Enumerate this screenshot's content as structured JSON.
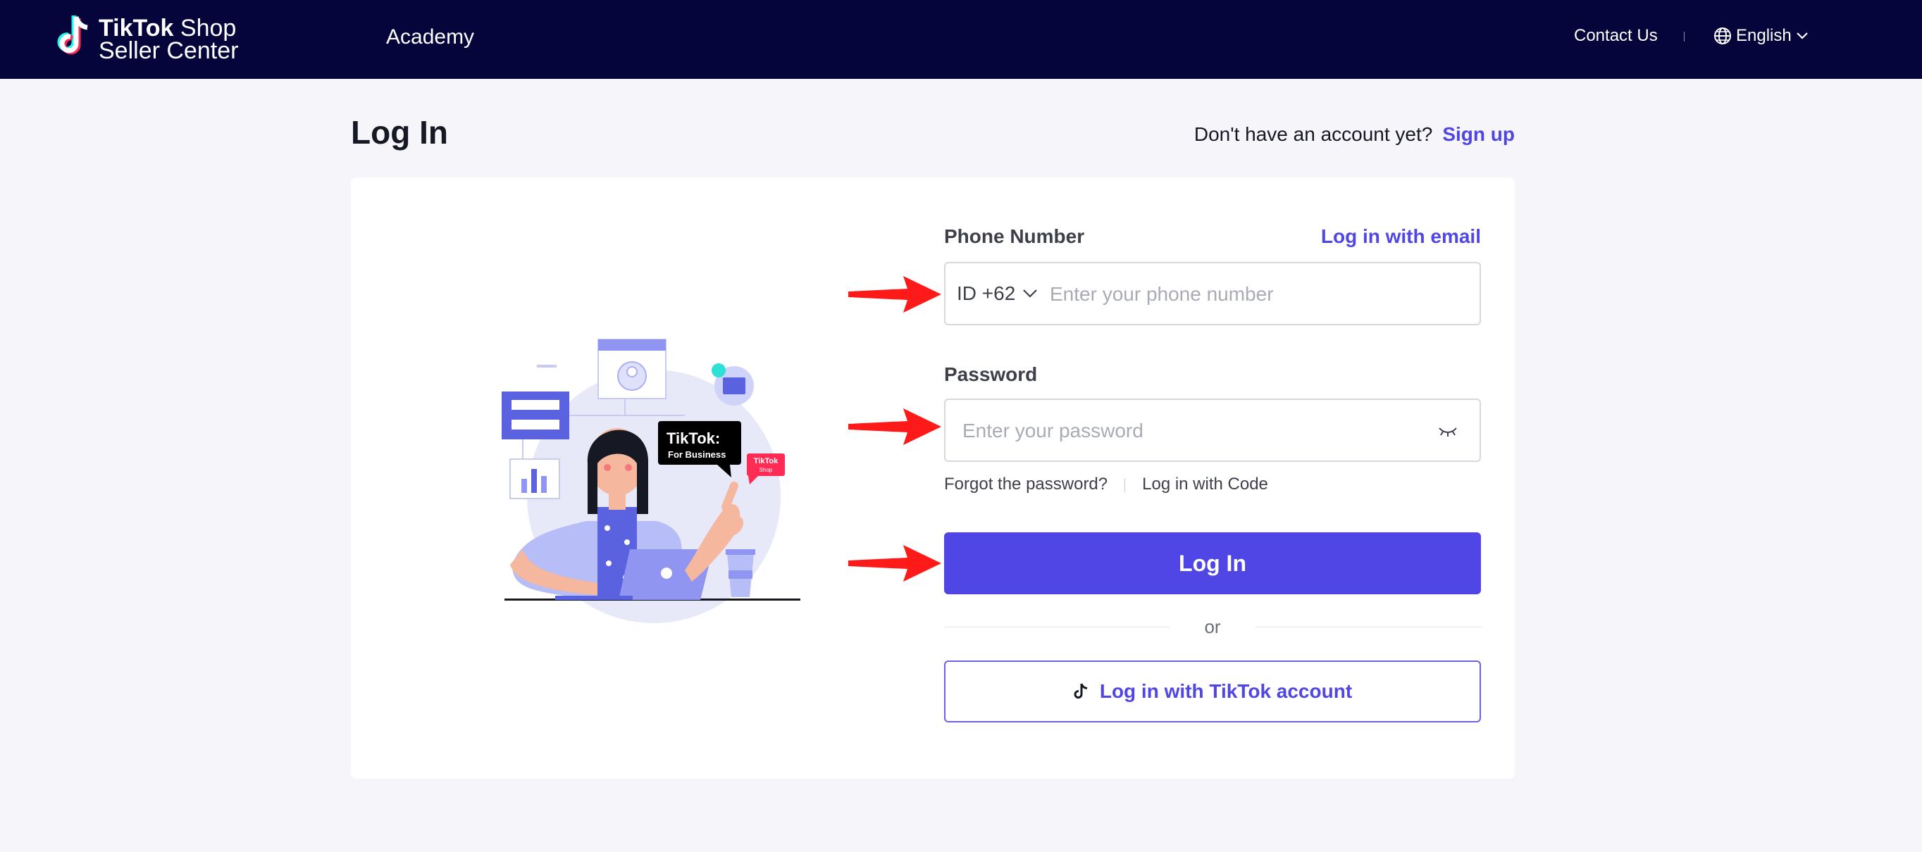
{
  "header": {
    "brand_tiktok": "TikTok",
    "brand_shop": "Shop",
    "brand_sub": "Seller Center",
    "academy": "Academy",
    "contact": "Contact Us",
    "language": "English"
  },
  "page": {
    "title": "Log In",
    "signup_prompt": "Don't have an account yet?",
    "signup_link": "Sign up"
  },
  "form": {
    "phone_label": "Phone Number",
    "email_link": "Log in with email",
    "country_code": "ID +62",
    "phone_placeholder": "Enter your phone number",
    "password_label": "Password",
    "password_placeholder": "Enter your password",
    "forgot": "Forgot the password?",
    "code_login": "Log in with Code",
    "login_button": "Log In",
    "or": "or",
    "tiktok_button": "Log in with TikTok account"
  },
  "illustration": {
    "badge_title": "TikTok:",
    "badge_sub": "For Business",
    "shop_tag_line1": "TikTok",
    "shop_tag_line2": "Shop"
  },
  "colors": {
    "topbar": "#05053c",
    "accent": "#4f46e5",
    "button": "#5046e5",
    "arrow": "#ff1a1a",
    "page_bg": "#f5f5fa"
  },
  "icons": {
    "logo": "tiktok-logo-icon",
    "language": "globe-icon",
    "dropdown": "chevron-down-icon",
    "password_visibility": "eye-closed-icon",
    "tiktok_button": "tiktok-note-icon",
    "annotation": "red-arrow-icon"
  }
}
